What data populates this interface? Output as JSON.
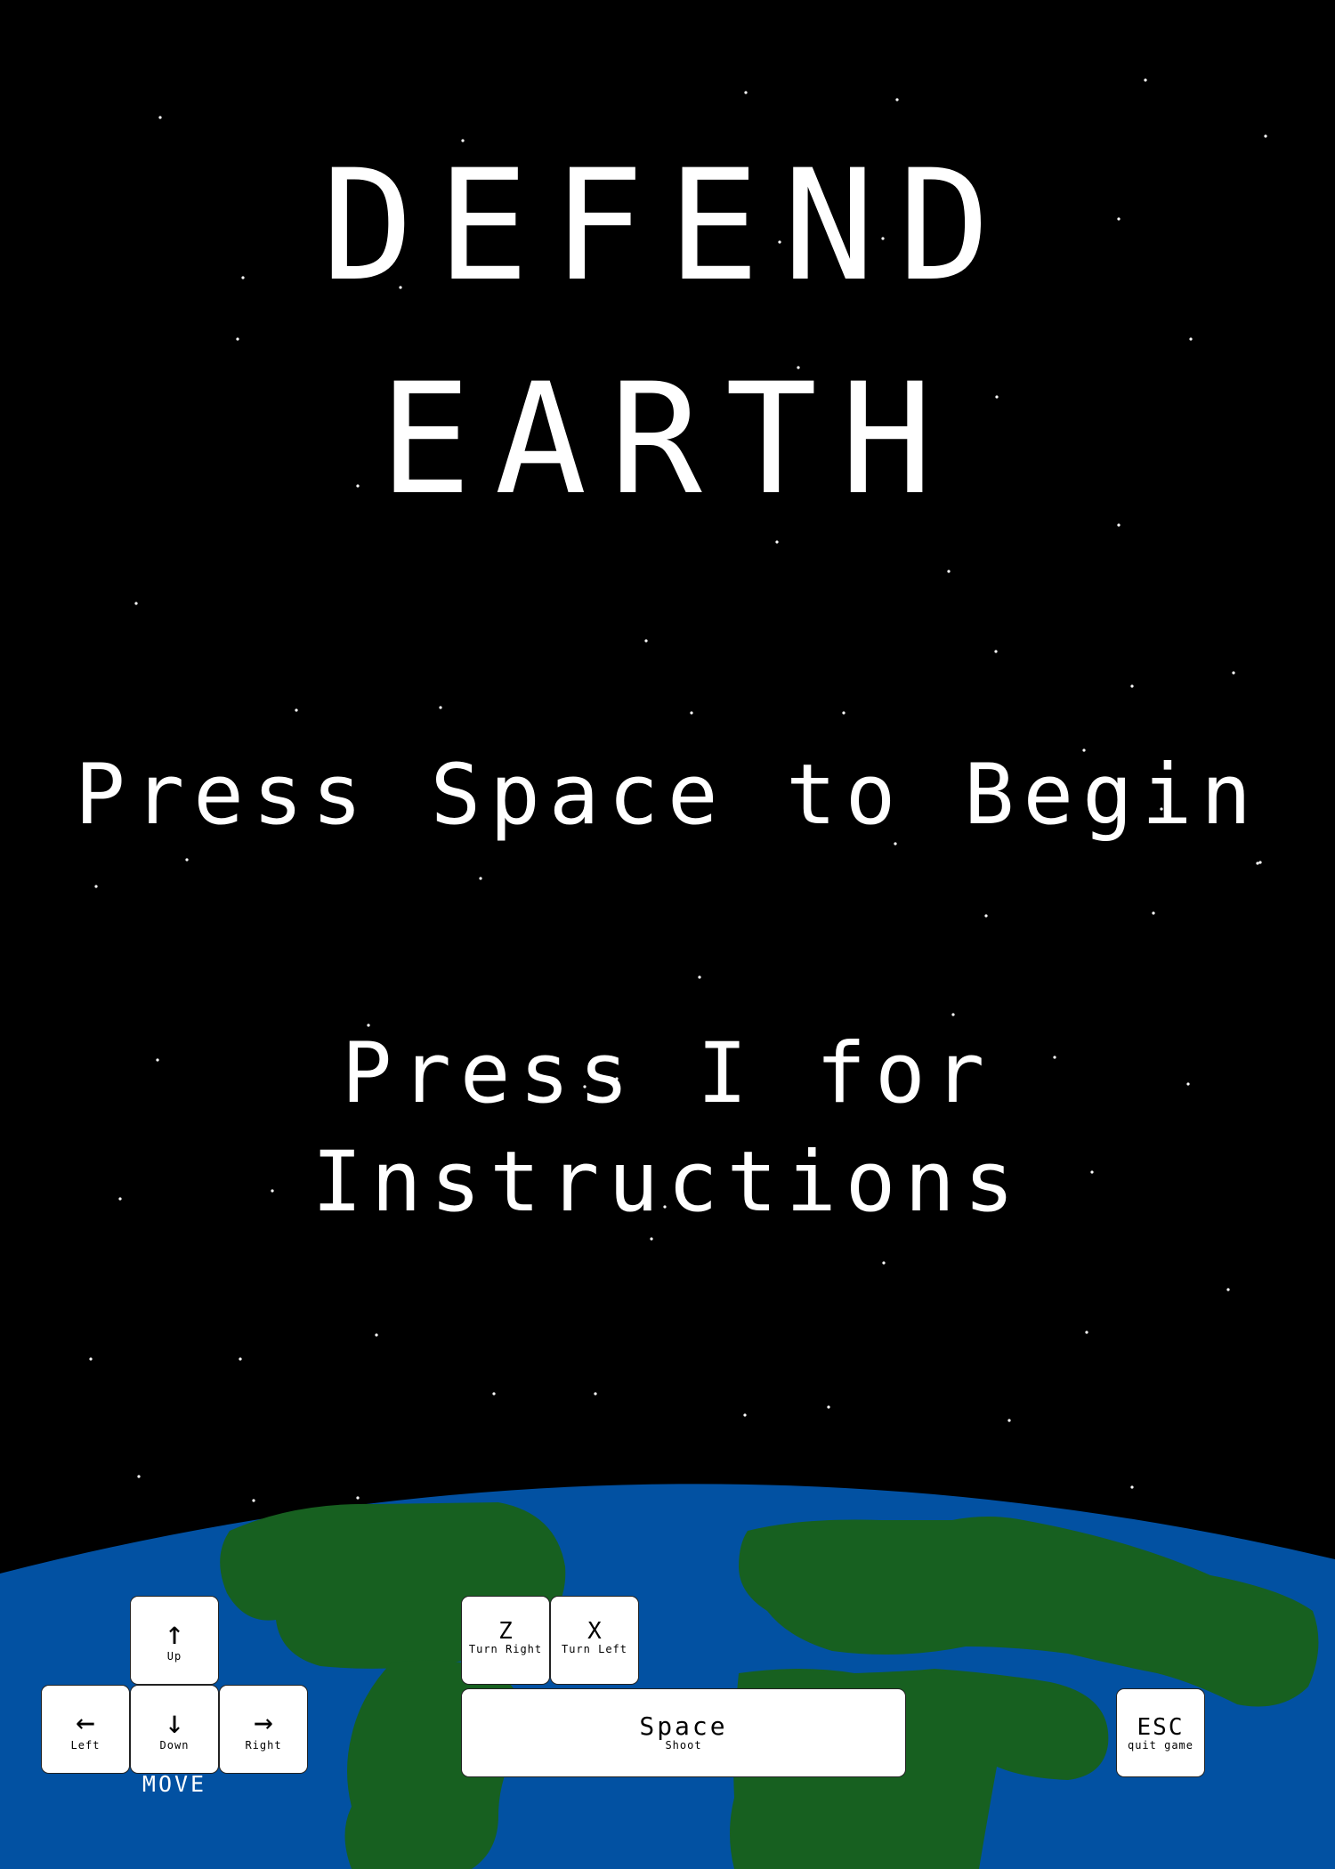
{
  "title": {
    "line1": "DEFEND",
    "line2": "EARTH"
  },
  "prompts": {
    "begin": "Press Space to Begin",
    "instructions_line1": "Press I for",
    "instructions_line2": "Instructions"
  },
  "controls": {
    "move_label": "MOVE",
    "up": {
      "glyph": "↑",
      "label": "Up"
    },
    "left": {
      "glyph": "←",
      "label": "Left"
    },
    "down": {
      "glyph": "↓",
      "label": "Down"
    },
    "right": {
      "glyph": "→",
      "label": "Right"
    },
    "z": {
      "glyph": "Z",
      "label": "Turn Right"
    },
    "x": {
      "glyph": "X",
      "label": "Turn Left"
    },
    "space": {
      "glyph": "Space",
      "label": "Shoot"
    },
    "esc": {
      "glyph": "ESC",
      "label": "quit game"
    }
  },
  "colors": {
    "space": "#000000",
    "ocean": "#0251a2",
    "land": "#176020",
    "text": "#ffffff",
    "key": "#ffffff"
  }
}
